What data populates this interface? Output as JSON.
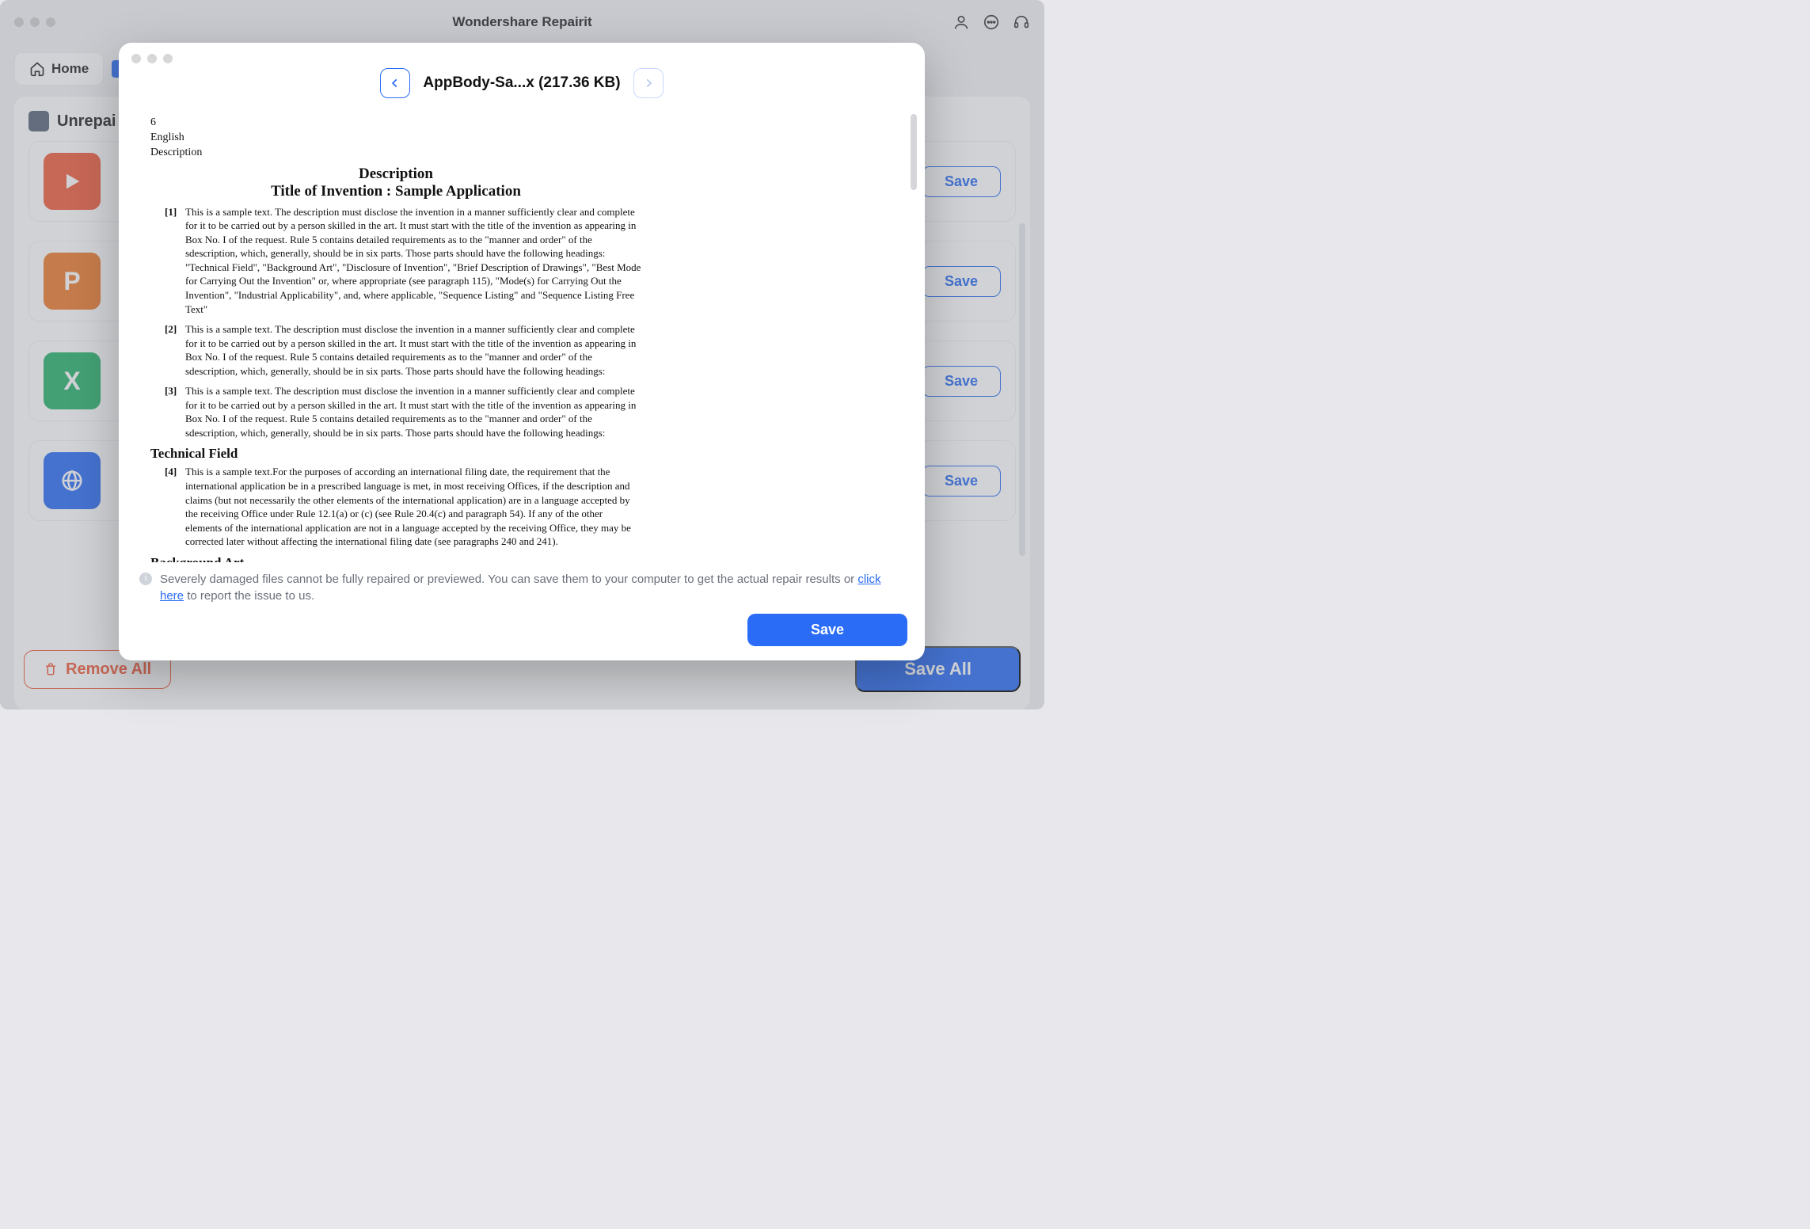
{
  "app": {
    "title": "Wondershare Repairit"
  },
  "toolbar": {
    "home_label": "Home"
  },
  "section": {
    "title": "Unrepai"
  },
  "file_rows": {
    "save_label": "Save",
    "thumbs": [
      "",
      "P",
      "X",
      ""
    ]
  },
  "bottom": {
    "remove_all": "Remove All",
    "save_all": "Save All"
  },
  "modal": {
    "title": "AppBody-Sa...x (217.36 KB)",
    "save_label": "Save",
    "notice_pre": "Severely damaged files cannot be fully repaired or previewed. You can save them to your computer to get the actual repair results or ",
    "notice_link": "click here",
    "notice_post": " to report the issue to us."
  },
  "doc": {
    "meta_num": "6",
    "meta_lang": "English",
    "meta_desc": "Description",
    "h1": "Description",
    "h2": "Title of Invention : Sample Application",
    "p1_num": "[1]",
    "p1": "This is a sample text. The description must disclose the invention in a manner sufficiently clear and complete for it to be carried out by a person skilled in the art. It must start with the title of the invention as appearing in Box No. I of the request. Rule 5 contains detailed requirements as to the \"manner and order\" of the sdescription, which, generally, should be in six parts. Those parts should have the following headings: \"Technical Field\", \"Background Art\", \"Disclosure of Invention\", \"Brief Description of Drawings\", \"Best Mode for Carrying Out the Invention\" or, where appropriate (see paragraph 115), \"Mode(s) for Carrying Out the Invention\", \"Industrial Applicability\", and, where applicable, \"Sequence Listing\" and \"Sequence Listing Free Text\"",
    "p2_num": "[2]",
    "p2": "This is a sample text. The description must disclose the invention in a manner sufficiently clear and complete for it to be carried out by a person skilled in the art. It must start with the title of the invention as appearing in Box No. I of the request. Rule 5 contains detailed requirements as to the \"manner and order\" of the sdescription, which, generally, should be in six parts. Those parts should have the following headings:",
    "p3_num": "[3]",
    "p3": "This is a sample text. The description must disclose the invention in a manner sufficiently clear and complete for it to be carried out by a person skilled in the art. It must start with the title of the invention as appearing in Box No. I of the request. Rule 5 contains detailed requirements as to the \"manner and order\" of the sdescription, which, generally, should be in six parts. Those parts should have the following headings:",
    "sec_tech": "Technical Field",
    "p4_num": "[4]",
    "p4": "This is a sample text.For the purposes of according an international filing date, the requirement that the international application be in a prescribed language is met, in most receiving Offices, if the description and claims (but not necessarily the other elements of the international application) are in a language accepted by the receiving Office under Rule 12.1(a) or (c) (see Rule 20.4(c) and paragraph 54). If any of the other elements of the international application are not in a language accepted by the receiving Office, they may be corrected later without affecting the international filing date (see paragraphs 240 and 241).",
    "sec_bg": "Background Art"
  }
}
